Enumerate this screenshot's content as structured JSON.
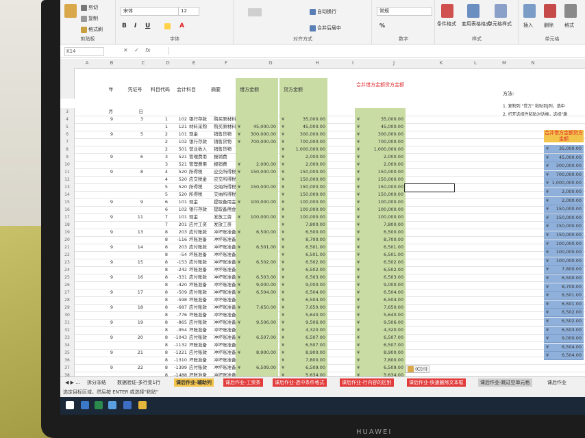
{
  "ribbon": {
    "clipboard": {
      "cut": "剪切",
      "copy": "复制",
      "painter": "格式刷",
      "label": "剪贴板"
    },
    "font": {
      "name": "宋体",
      "size": "12",
      "label": "字体"
    },
    "alignment": {
      "wrap": "自动换行",
      "merge": "合并后居中",
      "label": "对齐方式"
    },
    "number": {
      "format": "常规",
      "label": "数字"
    },
    "styles": {
      "cond": "条件格式",
      "table": "套用表格格式",
      "cell": "单元格样式",
      "label": "样式"
    },
    "cells": {
      "insert": "插入",
      "delete": "删除",
      "format": "格式",
      "label": "单元格"
    }
  },
  "formula_bar": {
    "name_box": "K14",
    "fx": "fx",
    "value": ""
  },
  "columns": [
    "A",
    "B",
    "C",
    "D",
    "E",
    "F",
    "G",
    "H",
    "I",
    "J",
    "K",
    "L",
    "M",
    "N"
  ],
  "headers": {
    "month": "年",
    "voucher": "凭证号",
    "subject_code": "科目代码",
    "subject": "会计科目",
    "summary": "摘要",
    "debit": "借方金额",
    "credit": "贷方金额",
    "merged": "合并借方金额贷方金额",
    "hint_title": "方法:",
    "hint1": "1. 复制列 \"贷方\" 粘贴到J列，选中",
    "hint2": "2. 打开选择性粘贴对话框，选择\"跳",
    "blue_header": "合并借方金额贷方金额"
  },
  "rows": [
    {
      "n": "3",
      "a": "月",
      "b": "日",
      "c": "",
      "d": "",
      "e": "",
      "f": "",
      "g": "",
      "h": "",
      "j": ""
    },
    {
      "n": "4",
      "a": "9",
      "b": "3",
      "c": "1",
      "d": "102",
      "e": "银行存款",
      "f": "购买原材料",
      "g": "",
      "h": "35,000.00",
      "j": "35,000.00"
    },
    {
      "n": "5",
      "a": "",
      "b": "",
      "c": "1",
      "d": "121",
      "e": "材料采购",
      "f": "购买原材料",
      "g": "45,000.00",
      "h": "45,000.00",
      "j": "45,000.00"
    },
    {
      "n": "6",
      "a": "9",
      "b": "5",
      "c": "2",
      "d": "101",
      "e": "现金",
      "f": "销售货物",
      "g": "300,000.00",
      "h": "300,000.00",
      "j": "300,000.00"
    },
    {
      "n": "7",
      "a": "",
      "b": "",
      "c": "2",
      "d": "102",
      "e": "银行存款",
      "f": "销售货物",
      "g": "700,000.00",
      "h": "700,000.00",
      "j": "700,000.00"
    },
    {
      "n": "8",
      "a": "",
      "b": "",
      "c": "2",
      "d": "501",
      "e": "营业收入",
      "f": "销售货物",
      "g": "",
      "h": "1,000,000.00",
      "j": "1,000,000.00"
    },
    {
      "n": "9",
      "a": "9",
      "b": "6",
      "c": "3",
      "d": "521",
      "e": "管理费用",
      "f": "报销费",
      "g": "",
      "h": "2,000.00",
      "j": "2,000.00"
    },
    {
      "n": "10",
      "a": "",
      "b": "",
      "c": "3",
      "d": "521",
      "e": "管理费用",
      "f": "报销费",
      "g": "2,000.00",
      "h": "2,000.00",
      "j": "2,000.00"
    },
    {
      "n": "11",
      "a": "9",
      "b": "8",
      "c": "4",
      "d": "520",
      "e": "所得税",
      "f": "应交所得税",
      "g": "150,000.00",
      "h": "150,000.00",
      "j": "150,000.00"
    },
    {
      "n": "12",
      "a": "",
      "b": "",
      "c": "4",
      "d": "520",
      "e": "应交税金",
      "f": "应交所得税",
      "g": "",
      "h": "150,000.00",
      "j": "150,000.00"
    },
    {
      "n": "13",
      "a": "",
      "b": "",
      "c": "5",
      "d": "520",
      "e": "所得税",
      "f": "交纳所得税",
      "g": "150,000.00",
      "h": "150,000.00",
      "j": "150,000.00"
    },
    {
      "n": "14",
      "a": "",
      "b": "",
      "c": "5",
      "d": "520",
      "e": "所得税",
      "f": "交纳所得税",
      "g": "",
      "h": "150,000.00",
      "j": "150,000.00"
    },
    {
      "n": "15",
      "a": "9",
      "b": "9",
      "c": "6",
      "d": "101",
      "e": "现金",
      "f": "提取备用金",
      "g": "100,000.00",
      "h": "100,000.00",
      "j": "100,000.00"
    },
    {
      "n": "16",
      "a": "",
      "b": "",
      "c": "6",
      "d": "102",
      "e": "银行存款",
      "f": "提取备用金",
      "g": "",
      "h": "100,000.00",
      "j": "100,000.00"
    },
    {
      "n": "17",
      "a": "9",
      "b": "11",
      "c": "7",
      "d": "101",
      "e": "现金",
      "f": "发放工资",
      "g": "100,000.00",
      "h": "100,000.00",
      "j": "100,000.00"
    },
    {
      "n": "18",
      "a": "",
      "b": "",
      "c": "7",
      "d": "201",
      "e": "应付工资",
      "f": "发放工资",
      "g": "",
      "h": "7,800.00",
      "j": "7,800.00"
    },
    {
      "n": "19",
      "a": "9",
      "b": "13",
      "c": "8",
      "d": "203",
      "e": "应付账款",
      "f": "冲坏账准备",
      "g": "6,500.00",
      "h": "6,500.00",
      "j": "6,500.00"
    },
    {
      "n": "20",
      "a": "",
      "b": "",
      "c": "8",
      "d": "-116",
      "e": "坏账准备",
      "f": "冲坏账准备",
      "g": "",
      "h": "8,700.00",
      "j": "8,700.00"
    },
    {
      "n": "21",
      "a": "9",
      "b": "14",
      "c": "8",
      "d": "203",
      "e": "应付账款",
      "f": "冲坏账准备",
      "g": "6,501.00",
      "h": "6,501.00",
      "j": "6,501.00"
    },
    {
      "n": "22",
      "a": "",
      "b": "",
      "c": "8",
      "d": "-54",
      "e": "坏账准备",
      "f": "冲坏账准备",
      "g": "",
      "h": "6,501.00",
      "j": "6,501.00"
    },
    {
      "n": "23",
      "a": "9",
      "b": "15",
      "c": "8",
      "d": "-153",
      "e": "应付账款",
      "f": "冲坏账准备",
      "g": "6,502.00",
      "h": "6,502.00",
      "j": "6,502.00"
    },
    {
      "n": "24",
      "a": "",
      "b": "",
      "c": "8",
      "d": "-242",
      "e": "坏账准备",
      "f": "冲坏账准备",
      "g": "",
      "h": "6,502.00",
      "j": "6,502.00"
    },
    {
      "n": "25",
      "a": "9",
      "b": "16",
      "c": "8",
      "d": "-331",
      "e": "应付账款",
      "f": "冲坏账准备",
      "g": "6,503.00",
      "h": "6,503.00",
      "j": "6,503.00"
    },
    {
      "n": "26",
      "a": "",
      "b": "",
      "c": "8",
      "d": "-420",
      "e": "坏账准备",
      "f": "冲坏账准备",
      "g": "9,000.00",
      "h": "9,000.00",
      "j": "9,000.00"
    },
    {
      "n": "27",
      "a": "9",
      "b": "17",
      "c": "8",
      "d": "-509",
      "e": "应付账款",
      "f": "冲坏账准备",
      "g": "6,504.00",
      "h": "6,504.00",
      "j": "6,504.00"
    },
    {
      "n": "28",
      "a": "",
      "b": "",
      "c": "8",
      "d": "-598",
      "e": "坏账准备",
      "f": "冲坏账准备",
      "g": "",
      "h": "6,504.00",
      "j": "6,504.00"
    },
    {
      "n": "29",
      "a": "9",
      "b": "18",
      "c": "8",
      "d": "-687",
      "e": "应付账款",
      "f": "冲坏账准备",
      "g": "7,650.00",
      "h": "7,650.00",
      "j": "7,650.00"
    },
    {
      "n": "30",
      "a": "",
      "b": "",
      "c": "8",
      "d": "-776",
      "e": "坏账准备",
      "f": "冲坏账准备",
      "g": "",
      "h": "5,640.00",
      "j": "5,640.00"
    },
    {
      "n": "31",
      "a": "9",
      "b": "19",
      "c": "8",
      "d": "-865",
      "e": "应付账款",
      "f": "冲坏账准备",
      "g": "9,506.00",
      "h": "9,506.00",
      "j": "9,506.00"
    },
    {
      "n": "32",
      "a": "",
      "b": "",
      "c": "8",
      "d": "-954",
      "e": "坏账准备",
      "f": "冲坏账准备",
      "g": "",
      "h": "4,320.00",
      "j": "4,320.00"
    },
    {
      "n": "33",
      "a": "9",
      "b": "20",
      "c": "8",
      "d": "-1043",
      "e": "应付账款",
      "f": "冲坏账准备",
      "g": "6,507.00",
      "h": "6,507.00",
      "j": "6,507.00"
    },
    {
      "n": "34",
      "a": "",
      "b": "",
      "c": "8",
      "d": "-1132",
      "e": "坏账准备",
      "f": "冲坏账准备",
      "g": "",
      "h": "6,507.00",
      "j": "6,507.00"
    },
    {
      "n": "35",
      "a": "9",
      "b": "21",
      "c": "8",
      "d": "-1221",
      "e": "应付账款",
      "f": "冲坏账准备",
      "g": "8,900.00",
      "h": "8,900.00",
      "j": "8,900.00"
    },
    {
      "n": "36",
      "a": "",
      "b": "",
      "c": "8",
      "d": "-1310",
      "e": "坏账准备",
      "f": "冲坏账准备",
      "g": "",
      "h": "7,800.00",
      "j": "7,800.00"
    },
    {
      "n": "37",
      "a": "9",
      "b": "22",
      "c": "8",
      "d": "-1399",
      "e": "应付账款",
      "f": "冲坏账准备",
      "g": "6,509.00",
      "h": "6,509.00",
      "j": "6,509.00"
    },
    {
      "n": "38",
      "a": "",
      "b": "",
      "c": "8",
      "d": "-1488",
      "e": "坏账准备",
      "f": "冲坏账准备",
      "g": "",
      "h": "5,634.00",
      "j": "5,634.00"
    },
    {
      "n": "39",
      "a": "",
      "b": "",
      "c": "",
      "d": "",
      "e": "",
      "f": "",
      "g": "",
      "h": "",
      "j": ""
    }
  ],
  "blue_values": [
    "35,000.00",
    "45,000.00",
    "300,000.00",
    "700,000.00",
    "1,000,000.00",
    "2,000.00",
    "2,000.00",
    "150,000.00",
    "150,000.00",
    "150,000.00",
    "150,000.00",
    "100,000.00",
    "100,000.00",
    "100,000.00",
    "7,800.00",
    "6,500.00",
    "8,700.00",
    "6,501.00",
    "6,501.00",
    "6,502.00",
    "6,502.00",
    "6,503.00",
    "9,000.00",
    "6,504.00",
    "6,504.00"
  ],
  "currency": "¥",
  "paste_options": "(Ctrl)",
  "tabs": [
    {
      "label": "◀ ▶ …",
      "style": "nav"
    },
    {
      "label": "拆分冻结",
      "style": "plain"
    },
    {
      "label": "数据验证-多行变1行",
      "style": "plain"
    },
    {
      "label": "课后作业-辅助列",
      "style": "active"
    },
    {
      "label": "课后作业-工资条",
      "style": "red"
    },
    {
      "label": "课后作业-选中条件格式",
      "style": "red"
    },
    {
      "label": "课后作业-行内容的区别",
      "style": "red"
    },
    {
      "label": "课后作业-快速删除文本框",
      "style": "red"
    },
    {
      "label": "课后作业-跳过空单元格",
      "style": "gray"
    },
    {
      "label": "课后作业",
      "style": "plain"
    }
  ],
  "status": "选定目标区域，然后按 ENTER 或选择\"粘贴\"",
  "brand": "HUAWEI",
  "colors": {
    "green": "#c9dca4",
    "blue": "#8fb0da",
    "red_tab": "#e23b3b",
    "active_tab": "#f3c44b"
  }
}
